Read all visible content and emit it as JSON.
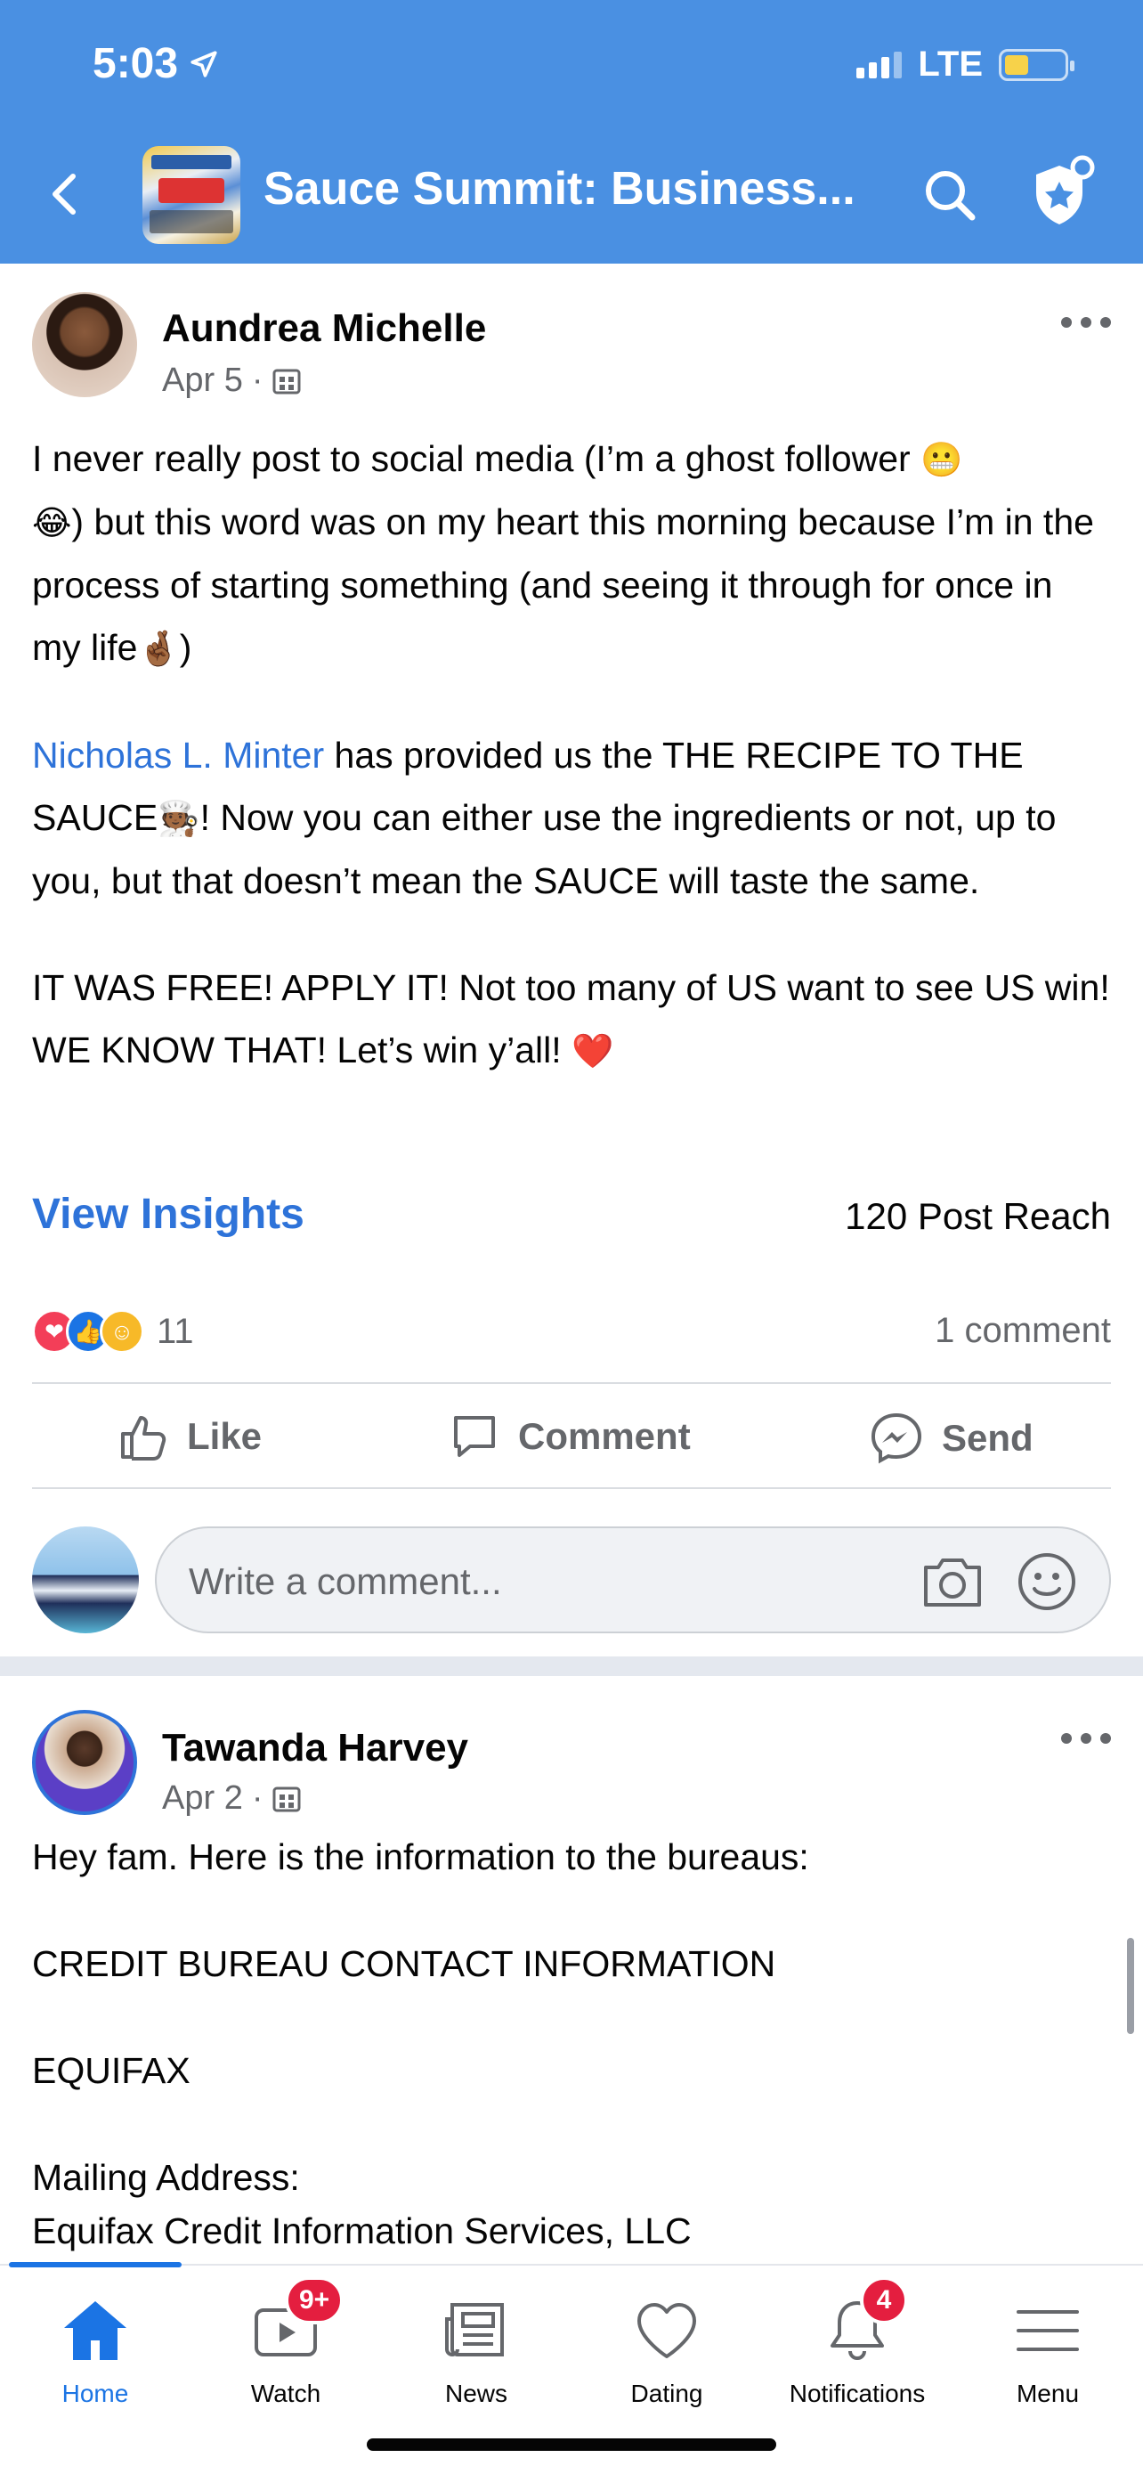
{
  "status_bar": {
    "time": "5:03",
    "network": "LTE"
  },
  "header": {
    "title": "Sauce Summit: Business..."
  },
  "post1": {
    "author": "Aundrea Michelle",
    "date": "Apr 5",
    "meta_sep": "·",
    "p1_text": "I never really post to social media (I’m a ghost follower ",
    "p1_emoji1": "😬",
    "p1_emoji2": "😂",
    "p1_text2": ") but this word was on my heart this morning because I’m in the process of starting something (and seeing it through for once in my life",
    "p1_emoji3": "🤞🏾",
    "p1_text3": ")",
    "p2_mention": "Nicholas L. Minter",
    "p2_text": " has provided us the THE RECIPE TO THE SAUCE",
    "p2_emoji": "🧑🏾‍🍳",
    "p2_text2": "! Now you can either use the ingredients or not, up to you, but that doesn’t mean the SAUCE will taste the same.",
    "p3_text": "IT WAS FREE! APPLY IT! Not too many of US want to see US win! WE KNOW THAT! Let’s win y’all! ",
    "p3_emoji": "❤️",
    "insights_label": "View Insights",
    "reach": "120 Post Reach",
    "reaction_count": "11",
    "comment_count": "1 comment",
    "actions": {
      "like": "Like",
      "comment": "Comment",
      "send": "Send"
    },
    "comment_placeholder": "Write a comment..."
  },
  "post2": {
    "author": "Tawanda Harvey",
    "date": "Apr 2",
    "meta_sep": "·",
    "lines": [
      "Hey fam. Here is the information to the bureaus:",
      "CREDIT BUREAU CONTACT INFORMATION",
      "EQUIFAX",
      "Mailing Address:",
      "Equifax Credit Information Services, LLC"
    ]
  },
  "tabbar": {
    "tabs": [
      {
        "label": "Home",
        "badge": ""
      },
      {
        "label": "Watch",
        "badge": "9+"
      },
      {
        "label": "News",
        "badge": ""
      },
      {
        "label": "Dating",
        "badge": ""
      },
      {
        "label": "Notifications",
        "badge": "4"
      },
      {
        "label": "Menu",
        "badge": ""
      }
    ]
  },
  "colors": {
    "header_bg": "#4a90e2",
    "link": "#2e73d9",
    "active_tab": "#1b74e4",
    "badge": "#e41e3f"
  }
}
